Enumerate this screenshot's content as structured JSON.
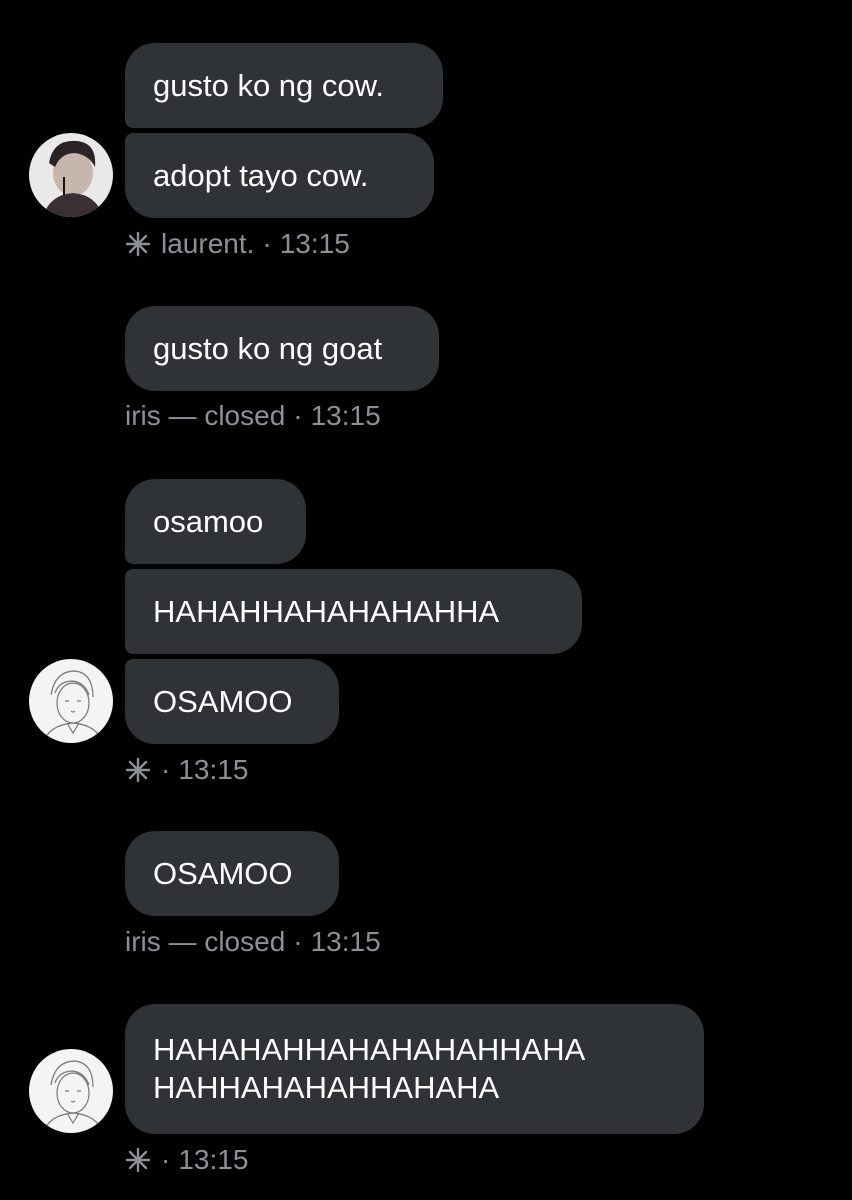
{
  "groups": [
    {
      "messages": [
        "gusto ko ng cow.",
        "adopt tayo cow."
      ],
      "meta": {
        "sender": "laurent.",
        "time": "13:15",
        "separator": "·"
      }
    },
    {
      "messages": [
        "gusto ko ng goat"
      ],
      "meta": {
        "sender": "iris — closed",
        "time": "13:15",
        "separator": "·"
      }
    },
    {
      "messages": [
        "osamoo",
        "HAHAHHAHAHAHAHHA",
        "OSAMOO"
      ],
      "meta": {
        "sender": "",
        "time": "13:15",
        "separator": "·"
      }
    },
    {
      "messages": [
        "OSAMOO"
      ],
      "meta": {
        "sender": "iris — closed",
        "time": "13:15",
        "separator": "·"
      }
    },
    {
      "messages": [
        "HAHAHAHHAHAHAHAHHAHA",
        "HAHHAHAHAHHAHAHA"
      ],
      "meta": {
        "sender": "",
        "time": "13:15",
        "separator": "·"
      }
    }
  ],
  "icons": {
    "sparkle": "sparkle-icon",
    "avatar_1": "avatar-dark-hair",
    "avatar_2": "avatar-sketch",
    "avatar_3": "avatar-sketch"
  },
  "colors": {
    "background": "#000000",
    "bubble": "#2f3336",
    "text": "#ffffff",
    "meta": "#8b9196"
  }
}
